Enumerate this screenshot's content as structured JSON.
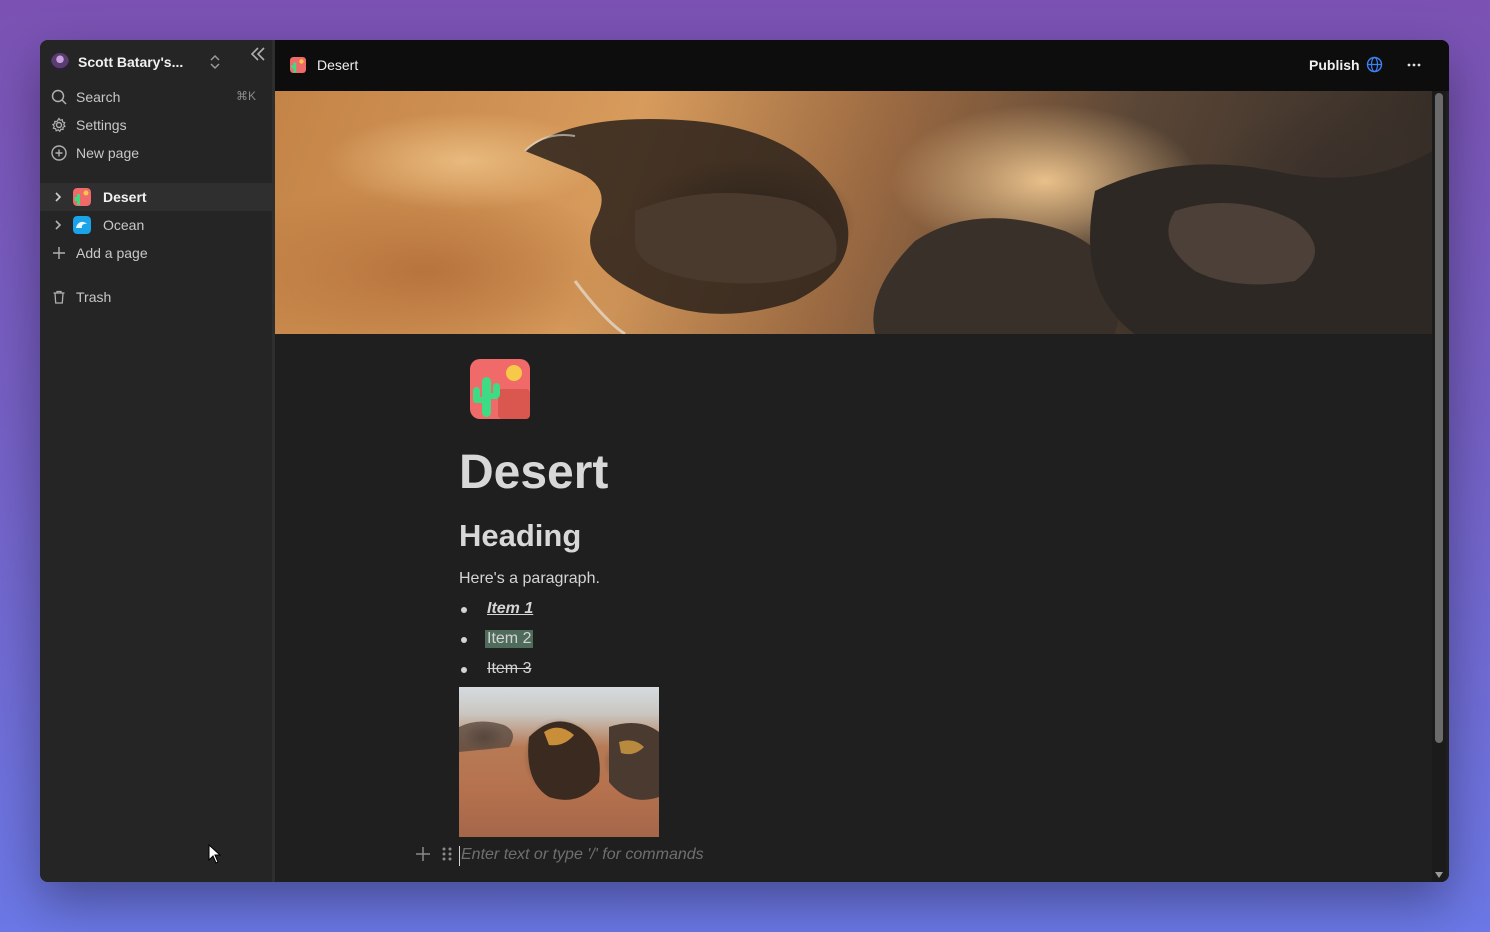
{
  "sidebar": {
    "workspace_name": "Scott Batary's...",
    "nav": [
      {
        "label": "Search",
        "icon": "search-icon",
        "shortcut": "⌘K"
      },
      {
        "label": "Settings",
        "icon": "gear-icon"
      },
      {
        "label": "New page",
        "icon": "plus-circle-icon"
      }
    ],
    "pages": [
      {
        "label": "Desert",
        "icon": "cactus-icon",
        "active": true
      },
      {
        "label": "Ocean",
        "icon": "wave-icon",
        "active": false
      }
    ],
    "add_page_label": "Add a page",
    "trash_label": "Trash"
  },
  "topbar": {
    "page_title": "Desert",
    "publish_label": "Publish"
  },
  "document": {
    "title": "Desert",
    "heading": "Heading",
    "paragraph": "Here's a paragraph.",
    "items": [
      "Item 1",
      "Item 2",
      "Item 3"
    ],
    "placeholder": "Enter text or type '/' for commands"
  },
  "colors": {
    "accent_globe": "#3b82f6",
    "highlight": "#4f6b5c",
    "background": "#1f1f1f"
  }
}
